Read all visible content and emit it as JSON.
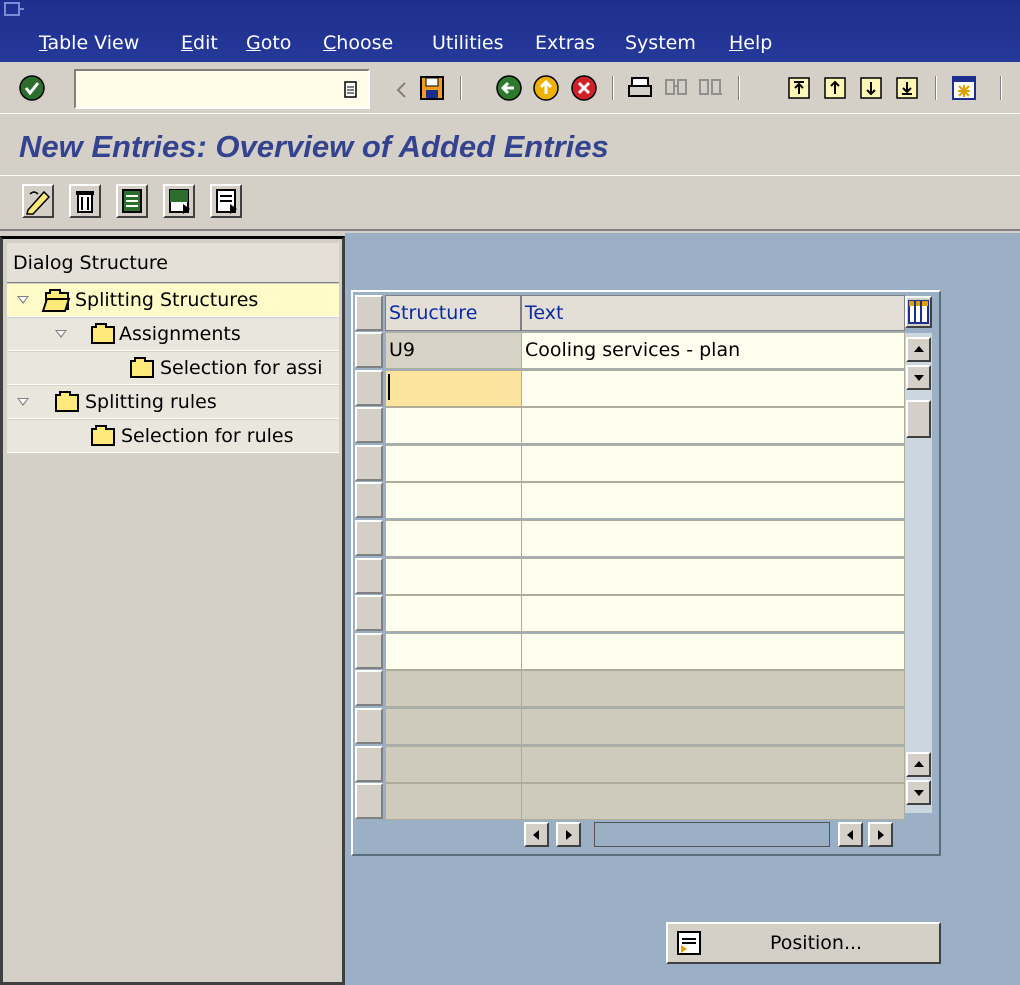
{
  "menu": {
    "items": [
      {
        "label": "Table View",
        "mnemonic": "T"
      },
      {
        "label": "Edit",
        "mnemonic": "E"
      },
      {
        "label": "Goto",
        "mnemonic": "G"
      },
      {
        "label": "Choose",
        "mnemonic": "C"
      },
      {
        "label": "Utilities"
      },
      {
        "label": "Extras"
      },
      {
        "label": "System"
      },
      {
        "label": "Help",
        "mnemonic": "H"
      }
    ]
  },
  "toolbar": {
    "command_field_value": "",
    "icons": [
      "enter-icon",
      "command-history-icon",
      "back-arrow-icon",
      "save-icon",
      "back-icon",
      "exit-icon",
      "cancel-icon",
      "print-icon",
      "find-icon",
      "find-next-icon",
      "first-page-icon",
      "previous-page-icon",
      "next-page-icon",
      "last-page-icon",
      "create-session-icon"
    ]
  },
  "page": {
    "title": "New Entries: Overview of Added Entries"
  },
  "app_toolbar": {
    "icons": [
      "change-display-icon",
      "delete-icon",
      "select-all-icon",
      "select-block-icon",
      "deselect-all-icon"
    ]
  },
  "dialog_structure": {
    "header": "Dialog Structure",
    "nodes": [
      {
        "label": "Splitting Structures",
        "expanded": true,
        "level": 0,
        "selected": true
      },
      {
        "label": "Assignments",
        "expanded": true,
        "level": 1
      },
      {
        "label": "Selection for assi",
        "level": 2
      },
      {
        "label": "Splitting rules",
        "expanded": true,
        "level": 0
      },
      {
        "label": "Selection for rules",
        "level": 1
      }
    ]
  },
  "table": {
    "columns": [
      "Structure",
      "Text"
    ],
    "rows": [
      {
        "structure": "U9",
        "text": "Cooling services - plan"
      },
      {
        "structure": "",
        "text": ""
      },
      {
        "structure": "",
        "text": ""
      },
      {
        "structure": "",
        "text": ""
      },
      {
        "structure": "",
        "text": ""
      },
      {
        "structure": "",
        "text": ""
      },
      {
        "structure": "",
        "text": ""
      },
      {
        "structure": "",
        "text": ""
      },
      {
        "structure": "",
        "text": ""
      },
      {
        "structure": "",
        "text": ""
      },
      {
        "structure": "",
        "text": ""
      },
      {
        "structure": "",
        "text": ""
      },
      {
        "structure": "",
        "text": ""
      }
    ]
  },
  "buttons": {
    "position": "Position..."
  },
  "colors": {
    "menubar": "#1d2f8e",
    "title": "#34438f",
    "workarea": "#9bb0c5",
    "input_row": "#fffff0",
    "selected_node": "#fffbc8"
  }
}
